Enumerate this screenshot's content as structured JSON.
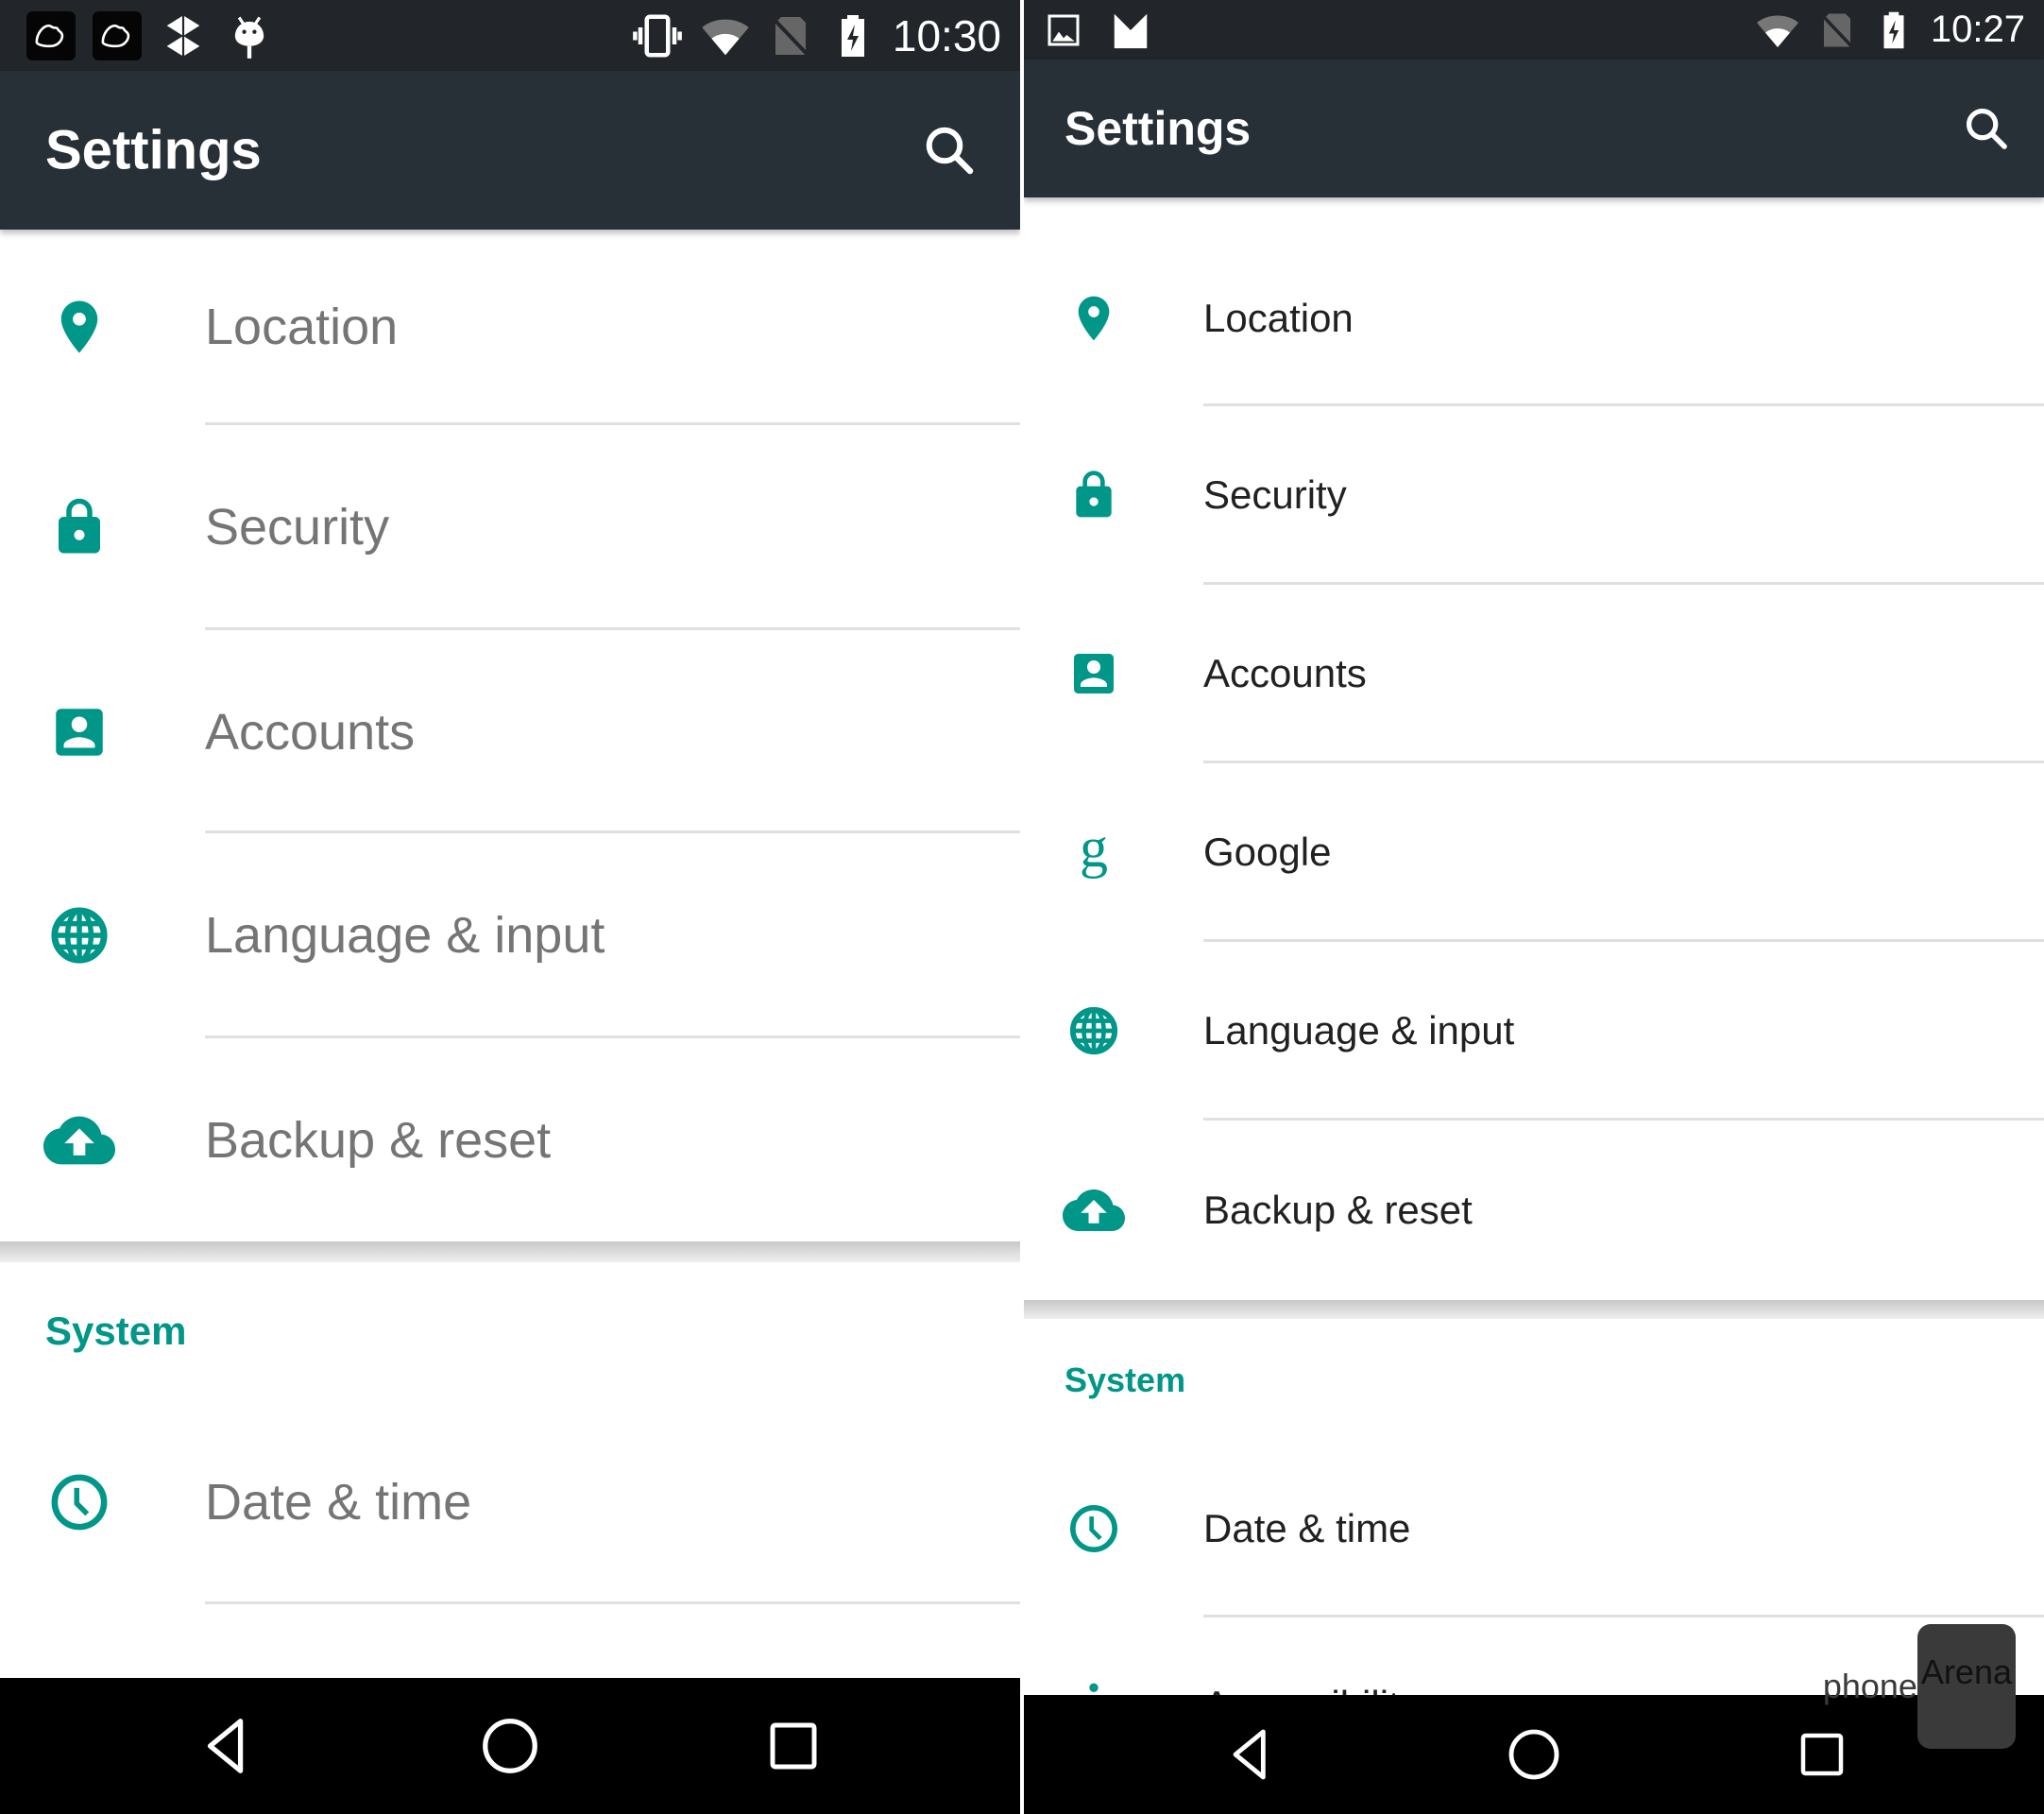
{
  "colors": {
    "accent": "#009688",
    "appbar": "#283037",
    "statusbar": "#22262a",
    "left_text": "#757575",
    "right_text": "#212121"
  },
  "left_phone": {
    "status_bar": {
      "left_icons": [
        "cloud-app-icon",
        "cloud-app-icon",
        "dropbox-icon",
        "android-debug-icon"
      ],
      "right_icons": [
        "vibrate-icon",
        "wifi-icon",
        "no-sim-icon",
        "battery-charging-icon"
      ],
      "time": "10:30"
    },
    "app_bar": {
      "title": "Settings",
      "search_icon": "search-icon"
    },
    "items": [
      {
        "label": "Location",
        "icon": "location-pin-icon"
      },
      {
        "label": "Security",
        "icon": "lock-icon"
      },
      {
        "label": "Accounts",
        "icon": "account-box-icon"
      },
      {
        "label": "Language & input",
        "icon": "globe-icon"
      },
      {
        "label": "Backup & reset",
        "icon": "cloud-upload-icon"
      }
    ],
    "section_header": "System",
    "system_items": [
      {
        "label": "Date & time",
        "icon": "clock-icon"
      }
    ],
    "nav": [
      "back-icon",
      "home-icon",
      "recents-icon"
    ]
  },
  "right_phone": {
    "status_bar": {
      "left_icons": [
        "gallery-icon",
        "gmail-icon"
      ],
      "right_icons": [
        "wifi-icon",
        "no-sim-icon",
        "battery-charging-icon"
      ],
      "time": "10:27"
    },
    "app_bar": {
      "title": "Settings",
      "search_icon": "search-icon"
    },
    "items": [
      {
        "label": "Location",
        "icon": "location-pin-icon"
      },
      {
        "label": "Security",
        "icon": "lock-icon"
      },
      {
        "label": "Accounts",
        "icon": "account-box-icon"
      },
      {
        "label": "Google",
        "icon": "google-g-icon"
      },
      {
        "label": "Language & input",
        "icon": "globe-icon"
      },
      {
        "label": "Backup & reset",
        "icon": "cloud-upload-icon"
      }
    ],
    "section_header": "System",
    "system_items": [
      {
        "label": "Date & time",
        "icon": "clock-icon"
      },
      {
        "label": "Accessibility",
        "icon": "accessibility-icon"
      }
    ],
    "nav": [
      "back-icon",
      "home-icon",
      "recents-icon"
    ],
    "watermark": {
      "part1": "phone",
      "part2": "Arena"
    }
  }
}
